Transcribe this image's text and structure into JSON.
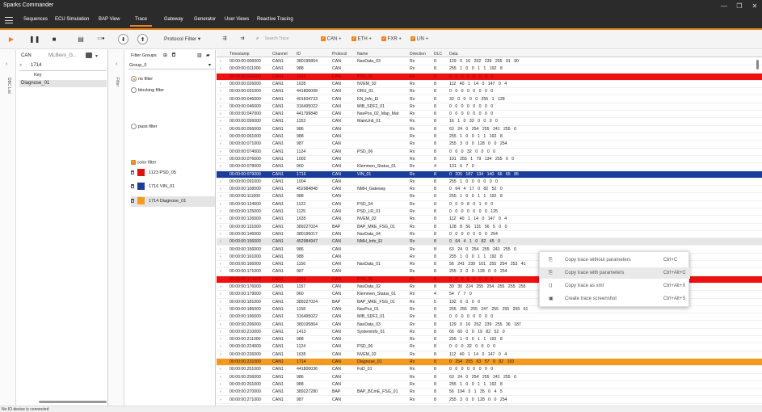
{
  "app": {
    "title": "Sparks Commander"
  },
  "menu": [
    "Sequences",
    "ECU Simulation",
    "BAP View",
    "Trace",
    "Gateway",
    "Generator",
    "User Views",
    "Reactive Tracing"
  ],
  "toolbar": {
    "protocol_filter": "Protocol Filter",
    "search_placeholder": "Search Trace",
    "protocols": [
      "CAN",
      "ETH",
      "FXR",
      "LIN"
    ]
  },
  "dbc": {
    "vertical_label": "DBC List",
    "bus": "CAN",
    "file": "MLBevo_G...",
    "search_value": "1714",
    "column": "Key",
    "item": "Diagnose_01"
  },
  "filter": {
    "vertical_label": "Filter",
    "groups_label": "Filter Groups",
    "group": "Group_0",
    "no_filter": "no filter",
    "blocking": "blocking filter",
    "pass": "pass filter",
    "color_filter": "color filter",
    "entries": [
      {
        "id": "1123",
        "name": "PSD_05",
        "color": "#e01010"
      },
      {
        "id": "1716",
        "name": "VIN_01",
        "color": "#1b3d9a"
      },
      {
        "id": "1714",
        "name": "Diagnose_01",
        "color": "#f59a1d"
      }
    ]
  },
  "trace": {
    "headers": [
      "Timestamp",
      "Channel",
      "ID",
      "Protocol",
      "Name",
      "Direction",
      "DLC",
      "Data"
    ],
    "rows": [
      [
        "00:00:00:006000",
        "CAN1",
        "380195864",
        "CAN",
        "NavData_03",
        "Rx",
        "8",
        "129 0 16 252 239 255 91 90",
        ""
      ],
      [
        "00:00:00:011000",
        "CAN1",
        "988",
        "CAN",
        "",
        "Rx",
        "8",
        "255 1 0 0 1 1 192 8",
        ""
      ],
      [
        "00:00:00:021000",
        "CAN1",
        "1123",
        "CAN",
        "PSD_05",
        "Rx",
        "8",
        "0 0 0 0 0 0 0 0",
        "red"
      ],
      [
        "00:00:00:026000",
        "CAN1",
        "1635",
        "CAN",
        "NVEM_02",
        "Rx",
        "8",
        "112 40 1 14 0 147 0 4",
        ""
      ],
      [
        "00:00:00:031000",
        "CAN1",
        "441800008",
        "CAN",
        "ORU_01",
        "Rx",
        "8",
        "0 0 0 0 0 0 0 0",
        ""
      ],
      [
        "00:00:00:046000",
        "CAN1",
        "401604723",
        "CAN",
        "KN_Info_El",
        "Rx",
        "8",
        "32 0 0 0 0 255 1 128",
        ""
      ],
      [
        "00:00:00:046000",
        "CAN1",
        "316495022",
        "CAN",
        "MIB_SDF2_01",
        "Rx",
        "8",
        "0 0 0 0 0 0 0 0",
        ""
      ],
      [
        "00:00:00:047000",
        "CAN1",
        "441799848",
        "CAN",
        "NavPos_02_Map_Mat",
        "Rx",
        "8",
        "0 0 0 0 0 0 0 0",
        ""
      ],
      [
        "00:00:00:056000",
        "CAN1",
        "1153",
        "CAN",
        "MainUnit_01",
        "Rx",
        "8",
        "16 1 0 33 0 0 0 0",
        ""
      ],
      [
        "00:00:00:056000",
        "CAN1",
        "986",
        "CAN",
        "",
        "Rx",
        "8",
        "63 24 0 254 255 241 255 0",
        ""
      ],
      [
        "00:00:00:061000",
        "CAN1",
        "988",
        "CAN",
        "",
        "Rx",
        "8",
        "255 1 0 0 1 1 192 8",
        ""
      ],
      [
        "00:00:00:071000",
        "CAN1",
        "987",
        "CAN",
        "",
        "Rx",
        "8",
        "255 3 0 0 128 0 0 254",
        ""
      ],
      [
        "00:00:00:074000",
        "CAN1",
        "1124",
        "CAN",
        "PSD_06",
        "Rx",
        "8",
        "0 0 0 32 0 0 0 0",
        ""
      ],
      [
        "00:00:00:076000",
        "CAN1",
        "1002",
        "CAN",
        "",
        "Rx",
        "8",
        "191 255 1 79 134 255 0 0",
        ""
      ],
      [
        "00:00:00:078000",
        "CAN1",
        "960",
        "CAN",
        "Klemmen_Status_01",
        "Rx",
        "4",
        "131 6 7 0",
        ""
      ],
      [
        "00:00:00:079000",
        "CAN1",
        "1716",
        "CAN",
        "VIN_01",
        "Rx",
        "8",
        "0 205 187 134 140 66 65 85",
        "blue"
      ],
      [
        "00:00:00:091000",
        "CAN1",
        "1004",
        "CAN",
        "",
        "Rx",
        "8",
        "255 1 0 0 0 0 0 0",
        ""
      ],
      [
        "00:00:00:108000",
        "CAN1",
        "452984848",
        "CAN",
        "NMH_Gateway",
        "Rx",
        "8",
        "0 64 4 17 0 82 52 0",
        ""
      ],
      [
        "00:00:00:111000",
        "CAN1",
        "988",
        "CAN",
        "",
        "Rx",
        "8",
        "255 1 0 0 1 1 192 8",
        ""
      ],
      [
        "00:00:00:124000",
        "CAN1",
        "1122",
        "CAN",
        "PSD_04",
        "Rx",
        "8",
        "0 0 0 8 0 1 0 0",
        ""
      ],
      [
        "00:00:00:125000",
        "CAN1",
        "1125",
        "CAN",
        "PSD_LR_01",
        "Rx",
        "8",
        "0 0 0 0 0 0 0 125",
        ""
      ],
      [
        "00:00:00:126000",
        "CAN1",
        "1635",
        "CAN",
        "NVEM_02",
        "Rx",
        "8",
        "112 40 1 14 0 147 0 4",
        ""
      ],
      [
        "00:00:00:131000",
        "CAN1",
        "389227024",
        "BAP",
        "BAP_MKE_FSG_01",
        "Rx",
        "8",
        "128 8 56 131 56 5 0 0",
        ""
      ],
      [
        "00:00:00:146000",
        "CAN1",
        "380196017",
        "CAN",
        "NavData_04",
        "Rx",
        "8",
        "0 0 0 0 0 0 0 254",
        ""
      ],
      [
        "00:00:00:156000",
        "CAN1",
        "452984947",
        "CAN",
        "NMH_Info_El",
        "Rx",
        "8",
        "0 64 4 1 0 82 45 0",
        "grey"
      ],
      [
        "00:00:00:156000",
        "CAN1",
        "986",
        "CAN",
        "",
        "Rx",
        "8",
        "63 24 0 254 255 241 255 0",
        ""
      ],
      [
        "00:00:00:161000",
        "CAN1",
        "988",
        "CAN",
        "",
        "Rx",
        "8",
        "255 1 0 0 1 1 192 8",
        ""
      ],
      [
        "00:00:00:166000",
        "CAN1",
        "1156",
        "CAN",
        "NavData_01",
        "Rx",
        "8",
        "56 241 239 101 255 254 253 41",
        ""
      ],
      [
        "00:00:00:171000",
        "CAN1",
        "987",
        "CAN",
        "",
        "Rx",
        "8",
        "255 3 0 0 128 0 0 254",
        ""
      ],
      [
        "00:00:00:174000",
        "CAN1",
        "1123",
        "CAN",
        "PSD_05",
        "Rx",
        "8",
        "0 0 0 0 0 0 0 0",
        "red"
      ],
      [
        "00:00:00:176000",
        "CAN1",
        "1157",
        "CAN",
        "NavData_02",
        "Rx",
        "8",
        "30 30 224 255 254 255 255 255",
        ""
      ],
      [
        "00:00:00:179000",
        "CAN1",
        "960",
        "CAN",
        "Klemmen_Status_01",
        "Rx",
        "4",
        "54 7 7 0",
        ""
      ],
      [
        "00:00:00:181000",
        "CAN1",
        "389227024",
        "BAP",
        "BAP_MKE_FSG_01",
        "Rx",
        "5",
        "192 0 0 0 0",
        ""
      ],
      [
        "00:00:00:186000",
        "CAN1",
        "1158",
        "CAN",
        "NavPos_01",
        "Rx",
        "8",
        "255 255 255 247 255 255 255 61",
        ""
      ],
      [
        "00:00:00:196000",
        "CAN1",
        "316495022",
        "CAN",
        "MIB_SDF2_01",
        "Rx",
        "8",
        "0 0 0 0 0 0 0 0",
        ""
      ],
      [
        "00:00:00:206000",
        "CAN1",
        "380195864",
        "CAN",
        "NavData_03",
        "Rx",
        "8",
        "129 0 16 252 239 255 36 187",
        ""
      ],
      [
        "00:00:00:210000",
        "CAN1",
        "1413",
        "CAN",
        "Systeminfo_01",
        "Rx",
        "8",
        "66 60 0 0 19 82 52 0",
        ""
      ],
      [
        "00:00:00:211000",
        "CAN1",
        "988",
        "CAN",
        "",
        "Rx",
        "8",
        "255 1 0 0 1 1 192 8",
        ""
      ],
      [
        "00:00:00:224000",
        "CAN1",
        "1124",
        "CAN",
        "PSD_06",
        "Rx",
        "8",
        "0 0 0 32 0 0 0 0",
        ""
      ],
      [
        "00:00:00:226000",
        "CAN1",
        "1635",
        "CAN",
        "NVEM_02",
        "Rx",
        "8",
        "112 40 1 14 0 147 0 4",
        ""
      ],
      [
        "00:00:00:231000",
        "CAN1",
        "1714",
        "CAN",
        "Diagnose_01",
        "Rx",
        "8",
        "0 254 255 63 57 9 82 193",
        "orange"
      ],
      [
        "00:00:00:251000",
        "CAN1",
        "441800036",
        "CAN",
        "FoD_01",
        "Rx",
        "8",
        "0 0 0 0 0 0 0 0",
        ""
      ],
      [
        "00:00:00:256000",
        "CAN1",
        "986",
        "CAN",
        "",
        "Rx",
        "8",
        "63 24 0 254 255 241 255 0",
        ""
      ],
      [
        "00:00:00:261000",
        "CAN1",
        "988",
        "CAN",
        "",
        "Rx",
        "8",
        "255 1 0 0 1 1 192 8",
        ""
      ],
      [
        "00:00:00:270000",
        "CAN1",
        "389227280",
        "BAP",
        "BAP_BCmE_FSG_01",
        "Rx",
        "8",
        "56 194 3 1 35 0 4 5",
        ""
      ],
      [
        "00:00:00:271000",
        "CAN1",
        "987",
        "CAN",
        "",
        "Rx",
        "8",
        "255 3 0 0 128 0 0 254",
        ""
      ]
    ]
  },
  "context_menu": [
    {
      "icon": "⎘",
      "label": "Copy trace without parameters",
      "shortcut": "Ctrl+C"
    },
    {
      "icon": "⎘",
      "label": "Copy trace with parameters",
      "shortcut": "Ctrl+Alt+C"
    },
    {
      "icon": "⟨⟩",
      "label": "Copy trace as xml",
      "shortcut": "Ctrl+Alt+X"
    },
    {
      "icon": "▣",
      "label": "Create trace screenshot",
      "shortcut": "Ctrl+Alt+S"
    }
  ],
  "status": "No IO device is connected"
}
